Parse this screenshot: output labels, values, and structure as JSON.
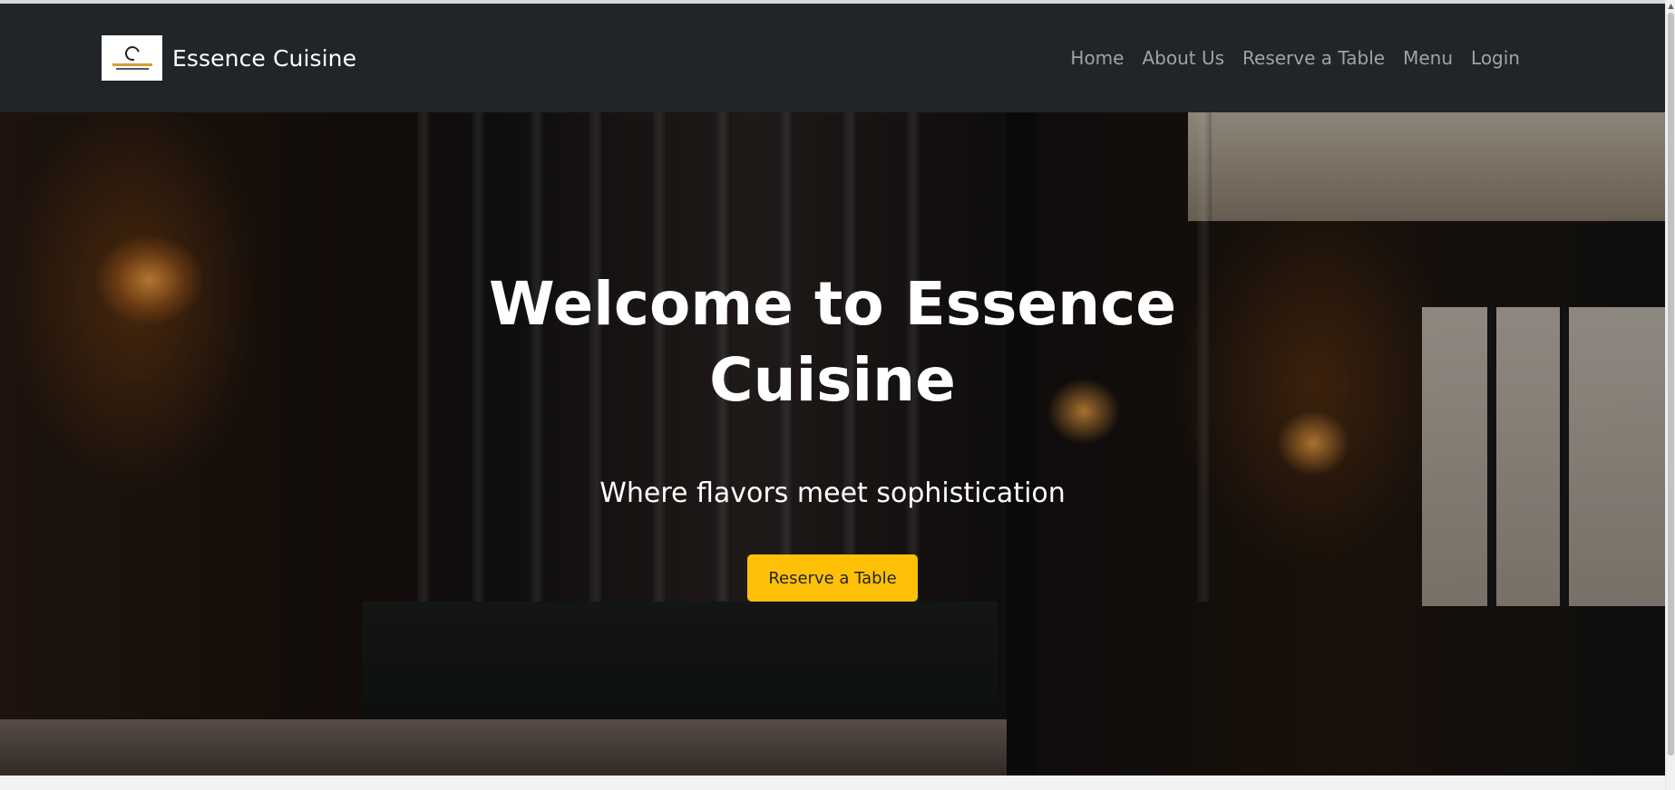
{
  "navbar": {
    "brand_name": "Essence Cuisine",
    "links": [
      "Home",
      "About Us",
      "Reserve a Table",
      "Menu",
      "Login"
    ]
  },
  "hero": {
    "title": "Welcome to Essence Cuisine",
    "subtitle": "Where flavors meet sophistication",
    "button_label": "Reserve a Table"
  },
  "colors": {
    "navbar_bg": "#212529",
    "accent": "#ffc107",
    "nav_link": "#9ea3a8"
  },
  "icons": {
    "logo": "restaurant-logo-icon",
    "scroll_up": "scroll-up-arrow-icon"
  }
}
